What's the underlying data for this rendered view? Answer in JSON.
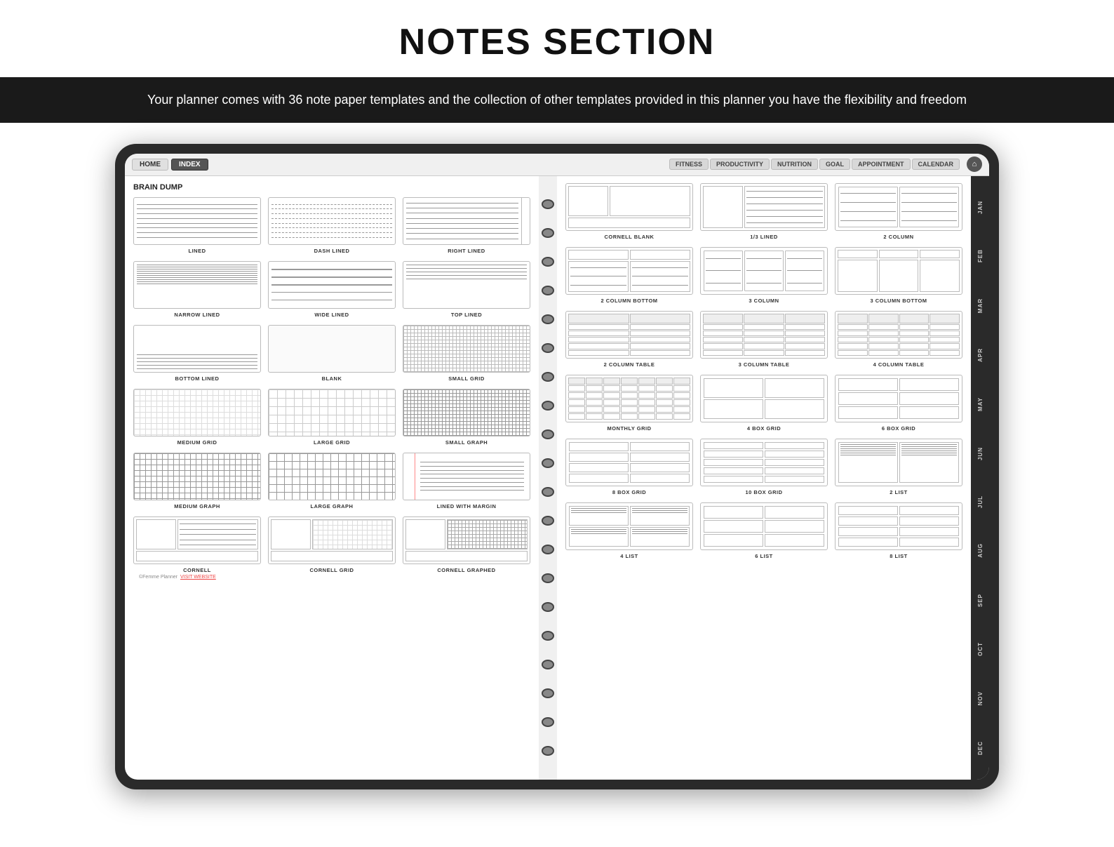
{
  "page": {
    "title": "NOTES SECTION",
    "subtitle": "Your planner comes with 36 note paper templates and the collection of other templates provided in this planner you have the flexibility and freedom"
  },
  "nav": {
    "left_buttons": [
      "HOME",
      "INDEX"
    ],
    "right_tabs": [
      "FITNESS",
      "PRODUCTIVITY",
      "NUTRITION",
      "GOAL",
      "APPOINTMENT",
      "CALENDAR"
    ],
    "brain_dump": "BRAIN DUMP"
  },
  "months": [
    "JAN",
    "FEB",
    "MAR",
    "APR",
    "MAY",
    "JUN",
    "JUL",
    "AUG",
    "SEP",
    "OCT",
    "NOV",
    "DEC"
  ],
  "left_templates": [
    {
      "label": "LINED",
      "type": "lined"
    },
    {
      "label": "DASH LINED",
      "type": "dash"
    },
    {
      "label": "RIGHT LINED",
      "type": "right-lined"
    },
    {
      "label": "NARROW LINED",
      "type": "narrow-lined"
    },
    {
      "label": "WIDE LINED",
      "type": "wide-lined"
    },
    {
      "label": "TOP LINED",
      "type": "top-lined"
    },
    {
      "label": "BOTTOM LINED",
      "type": "bottom-lined"
    },
    {
      "label": "BLANK",
      "type": "blank"
    },
    {
      "label": "SMALL GRID",
      "type": "small-grid"
    },
    {
      "label": "MEDIUM GRID",
      "type": "medium-grid"
    },
    {
      "label": "LARGE GRID",
      "type": "large-grid"
    },
    {
      "label": "SMALL GRAPH",
      "type": "small-graph"
    },
    {
      "label": "MEDIUM GRAPH",
      "type": "medium-graph"
    },
    {
      "label": "LARGE GRAPH",
      "type": "large-graph"
    },
    {
      "label": "LINED WITH MARGIN",
      "type": "lined-margin"
    },
    {
      "label": "CORNELL",
      "type": "cornell"
    },
    {
      "label": "CORNELL GRID",
      "type": "cornell-grid"
    },
    {
      "label": "CORNELL GRAPHED",
      "type": "cornell-graphed"
    }
  ],
  "right_templates": [
    {
      "label": "CORNELL BLANK",
      "type": "cornell-blank"
    },
    {
      "label": "1/3 LINED",
      "type": "one-third-lined"
    },
    {
      "label": "2 COLUMN",
      "type": "two-column"
    },
    {
      "label": "2 COLUMN BOTTOM",
      "type": "two-column-bottom"
    },
    {
      "label": "3 COLUMN",
      "type": "three-column"
    },
    {
      "label": "3 COLUMN BOTTOM",
      "type": "three-column-bottom"
    },
    {
      "label": "2 COLUMN TABLE",
      "type": "two-col-table"
    },
    {
      "label": "3 COLUMN TABLE",
      "type": "three-col-table"
    },
    {
      "label": "4 COLUMN TABLE",
      "type": "four-col-table"
    },
    {
      "label": "MONTHLY GRID",
      "type": "monthly-grid"
    },
    {
      "label": "4 BOX GRID",
      "type": "four-box"
    },
    {
      "label": "6 BOX GRID",
      "type": "six-box"
    },
    {
      "label": "8 BOX GRID",
      "type": "eight-box"
    },
    {
      "label": "10 BOX GRID",
      "type": "ten-box"
    },
    {
      "label": "2 LIST",
      "type": "two-list"
    },
    {
      "label": "4 LIST",
      "type": "four-list"
    },
    {
      "label": "6 LIST",
      "type": "six-list"
    },
    {
      "label": "8 LIST",
      "type": "eight-list"
    }
  ],
  "copyright": "©Femme Planner VISIT WEBSITE"
}
